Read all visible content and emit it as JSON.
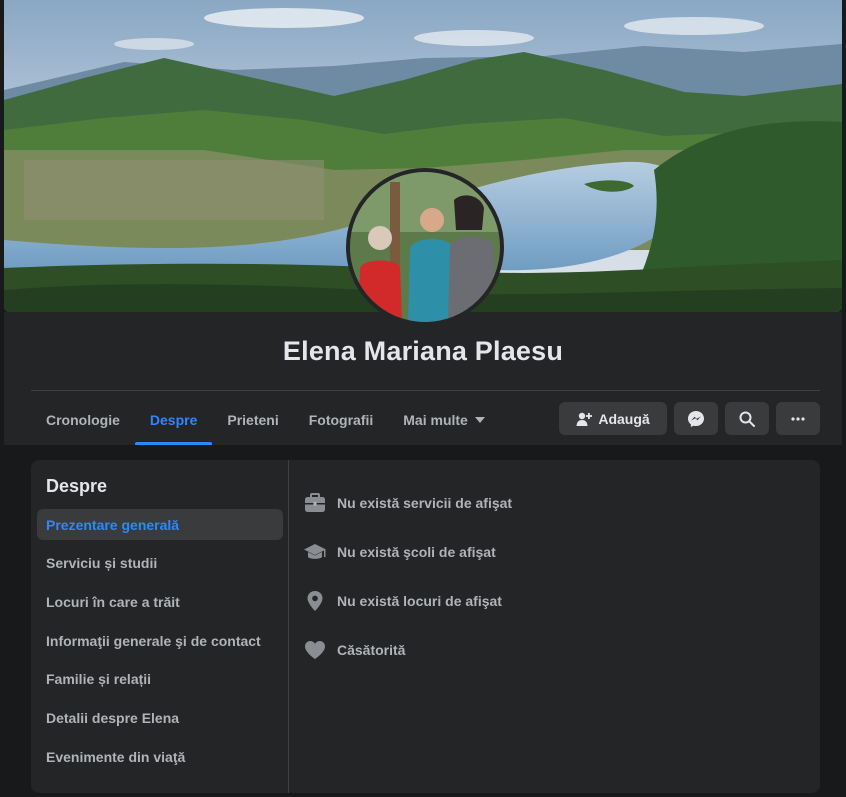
{
  "profile": {
    "name": "Elena Mariana Plaesu"
  },
  "tabs": [
    {
      "label": "Cronologie",
      "active": false
    },
    {
      "label": "Despre",
      "active": true
    },
    {
      "label": "Prieteni",
      "active": false
    },
    {
      "label": "Fotografii",
      "active": false
    },
    {
      "label": "Mai multe",
      "active": false
    }
  ],
  "actions": {
    "add_label": "Adaugă"
  },
  "about": {
    "title": "Despre",
    "nav": [
      {
        "label": "Prezentare generală",
        "active": true
      },
      {
        "label": "Serviciu și studii",
        "active": false
      },
      {
        "label": "Locuri în care a trăit",
        "active": false
      },
      {
        "label": "Informaţii generale şi de contact",
        "active": false
      },
      {
        "label": "Familie și relații",
        "active": false
      },
      {
        "label": "Detalii despre Elena",
        "active": false
      },
      {
        "label": "Evenimente din viaţă",
        "active": false
      }
    ],
    "info": [
      {
        "icon": "briefcase-icon",
        "text": "Nu există servicii de afişat"
      },
      {
        "icon": "graduation-cap-icon",
        "text": "Nu există şcoli de afişat"
      },
      {
        "icon": "location-pin-icon",
        "text": "Nu există locuri de afişat"
      },
      {
        "icon": "heart-icon",
        "text": "Căsătorită"
      }
    ]
  },
  "colors": {
    "accent": "#2d88ff",
    "surface": "#242526",
    "background": "#18191a",
    "button": "#3a3b3c"
  }
}
